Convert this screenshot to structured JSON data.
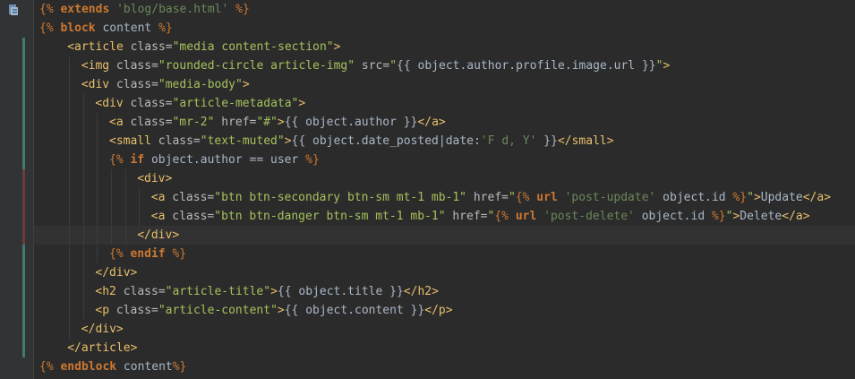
{
  "editor": {
    "lines": [
      {
        "tokens": [
          [
            "tpl",
            "{% "
          ],
          [
            "tplk",
            "extends"
          ],
          [
            "txt",
            " "
          ],
          [
            "str",
            "'blog/base.html'"
          ],
          [
            "tpl",
            " %}"
          ]
        ],
        "indent": 0
      },
      {
        "tokens": [
          [
            "tpl",
            "{% "
          ],
          [
            "tplk",
            "block"
          ],
          [
            "txt",
            " content "
          ],
          [
            "tpl",
            "%}"
          ]
        ],
        "indent": 0
      },
      {
        "tokens": [
          [
            "tag",
            "<article"
          ],
          [
            "attr",
            " class="
          ],
          [
            "strg",
            "\"media content-section\""
          ],
          [
            "tag",
            ">"
          ]
        ],
        "indent": 4
      },
      {
        "tokens": [
          [
            "tag",
            "<img"
          ],
          [
            "attr",
            " class="
          ],
          [
            "strg",
            "\"rounded-circle article-img\""
          ],
          [
            "attr",
            " src="
          ],
          [
            "strg",
            "\""
          ],
          [
            "txt",
            "{{ object.author.profile.image.url }}"
          ],
          [
            "strg",
            "\""
          ],
          [
            "tag",
            ">"
          ]
        ],
        "indent": 6
      },
      {
        "tokens": [
          [
            "tag",
            "<div"
          ],
          [
            "attr",
            " class="
          ],
          [
            "strg",
            "\"media-body\""
          ],
          [
            "tag",
            ">"
          ]
        ],
        "indent": 6
      },
      {
        "tokens": [
          [
            "tag",
            "<div"
          ],
          [
            "attr",
            " class="
          ],
          [
            "strg",
            "\"article-metadata\""
          ],
          [
            "tag",
            ">"
          ]
        ],
        "indent": 8
      },
      {
        "tokens": [
          [
            "tag",
            "<a"
          ],
          [
            "attr",
            " class="
          ],
          [
            "strg",
            "\"mr-2\""
          ],
          [
            "attr",
            " href="
          ],
          [
            "strg",
            "\"#\""
          ],
          [
            "tag",
            ">"
          ],
          [
            "txt",
            "{{ object.author }}"
          ],
          [
            "tag",
            "</a>"
          ]
        ],
        "indent": 10
      },
      {
        "tokens": [
          [
            "tag",
            "<small"
          ],
          [
            "attr",
            " class="
          ],
          [
            "strg",
            "\"text-muted\""
          ],
          [
            "tag",
            ">"
          ],
          [
            "txt",
            "{{ object.date_posted|date:"
          ],
          [
            "str",
            "'F d, Y'"
          ],
          [
            "txt",
            " }}"
          ],
          [
            "tag",
            "</small>"
          ]
        ],
        "indent": 10
      },
      {
        "tokens": [
          [
            "tpl",
            "{% "
          ],
          [
            "tplk",
            "if"
          ],
          [
            "txt",
            " object.author == user "
          ],
          [
            "tpl",
            "%}"
          ]
        ],
        "indent": 10
      },
      {
        "tokens": [
          [
            "tag",
            "<div>"
          ]
        ],
        "indent": 14
      },
      {
        "tokens": [
          [
            "tag",
            "<a"
          ],
          [
            "attr",
            " class="
          ],
          [
            "strg",
            "\"btn btn-secondary btn-sm mt-1 mb-1\""
          ],
          [
            "attr",
            " href="
          ],
          [
            "strg",
            "\""
          ],
          [
            "tpl",
            "{% "
          ],
          [
            "tplk",
            "url"
          ],
          [
            "txt",
            " "
          ],
          [
            "str",
            "'post-update'"
          ],
          [
            "txt",
            " object.id "
          ],
          [
            "tpl",
            "%}"
          ],
          [
            "strg",
            "\""
          ],
          [
            "tag",
            ">"
          ],
          [
            "txt",
            "Update"
          ],
          [
            "tag",
            "</a>"
          ]
        ],
        "indent": 16
      },
      {
        "tokens": [
          [
            "tag",
            "<a"
          ],
          [
            "attr",
            " class="
          ],
          [
            "strg",
            "\"btn btn-danger btn-sm mt-1 mb-1\""
          ],
          [
            "attr",
            " href="
          ],
          [
            "strg",
            "\""
          ],
          [
            "tpl",
            "{% "
          ],
          [
            "tplk",
            "url"
          ],
          [
            "txt",
            " "
          ],
          [
            "str",
            "'post-delete'"
          ],
          [
            "txt",
            " object.id "
          ],
          [
            "tpl",
            "%}"
          ],
          [
            "strg",
            "\""
          ],
          [
            "tag",
            ">"
          ],
          [
            "txt",
            "Delete"
          ],
          [
            "tag",
            "</a>"
          ]
        ],
        "indent": 16
      },
      {
        "tokens": [
          [
            "tag",
            "</div>"
          ]
        ],
        "indent": 14
      },
      {
        "tokens": [
          [
            "tpl",
            "{% "
          ],
          [
            "tplk",
            "endif"
          ],
          [
            "txt",
            " "
          ],
          [
            "tpl",
            "%}"
          ]
        ],
        "indent": 10
      },
      {
        "tokens": [
          [
            "tag",
            "</div>"
          ]
        ],
        "indent": 8
      },
      {
        "tokens": [
          [
            "tag",
            "<h2"
          ],
          [
            "attr",
            " class="
          ],
          [
            "strg",
            "\"article-title\""
          ],
          [
            "tag",
            ">"
          ],
          [
            "txt",
            "{{ object.title }}"
          ],
          [
            "tag",
            "</h2>"
          ]
        ],
        "indent": 8
      },
      {
        "tokens": [
          [
            "tag",
            "<p"
          ],
          [
            "attr",
            " class="
          ],
          [
            "strg",
            "\"article-content\""
          ],
          [
            "tag",
            ">"
          ],
          [
            "txt",
            "{{ object.content }}"
          ],
          [
            "tag",
            "</p>"
          ]
        ],
        "indent": 8
      },
      {
        "tokens": [
          [
            "tag",
            "</div>"
          ]
        ],
        "indent": 6
      },
      {
        "tokens": [
          [
            "tag",
            "</article>"
          ]
        ],
        "indent": 4
      },
      {
        "tokens": [
          [
            "tpl",
            "{% "
          ],
          [
            "tplk",
            "endblock"
          ],
          [
            "txt",
            " content"
          ],
          [
            "tpl",
            "%}"
          ]
        ],
        "indent": 0
      }
    ],
    "current_line": 12,
    "intention_icon": "lightbulb-icon",
    "file_icon": "django-template-icon"
  }
}
